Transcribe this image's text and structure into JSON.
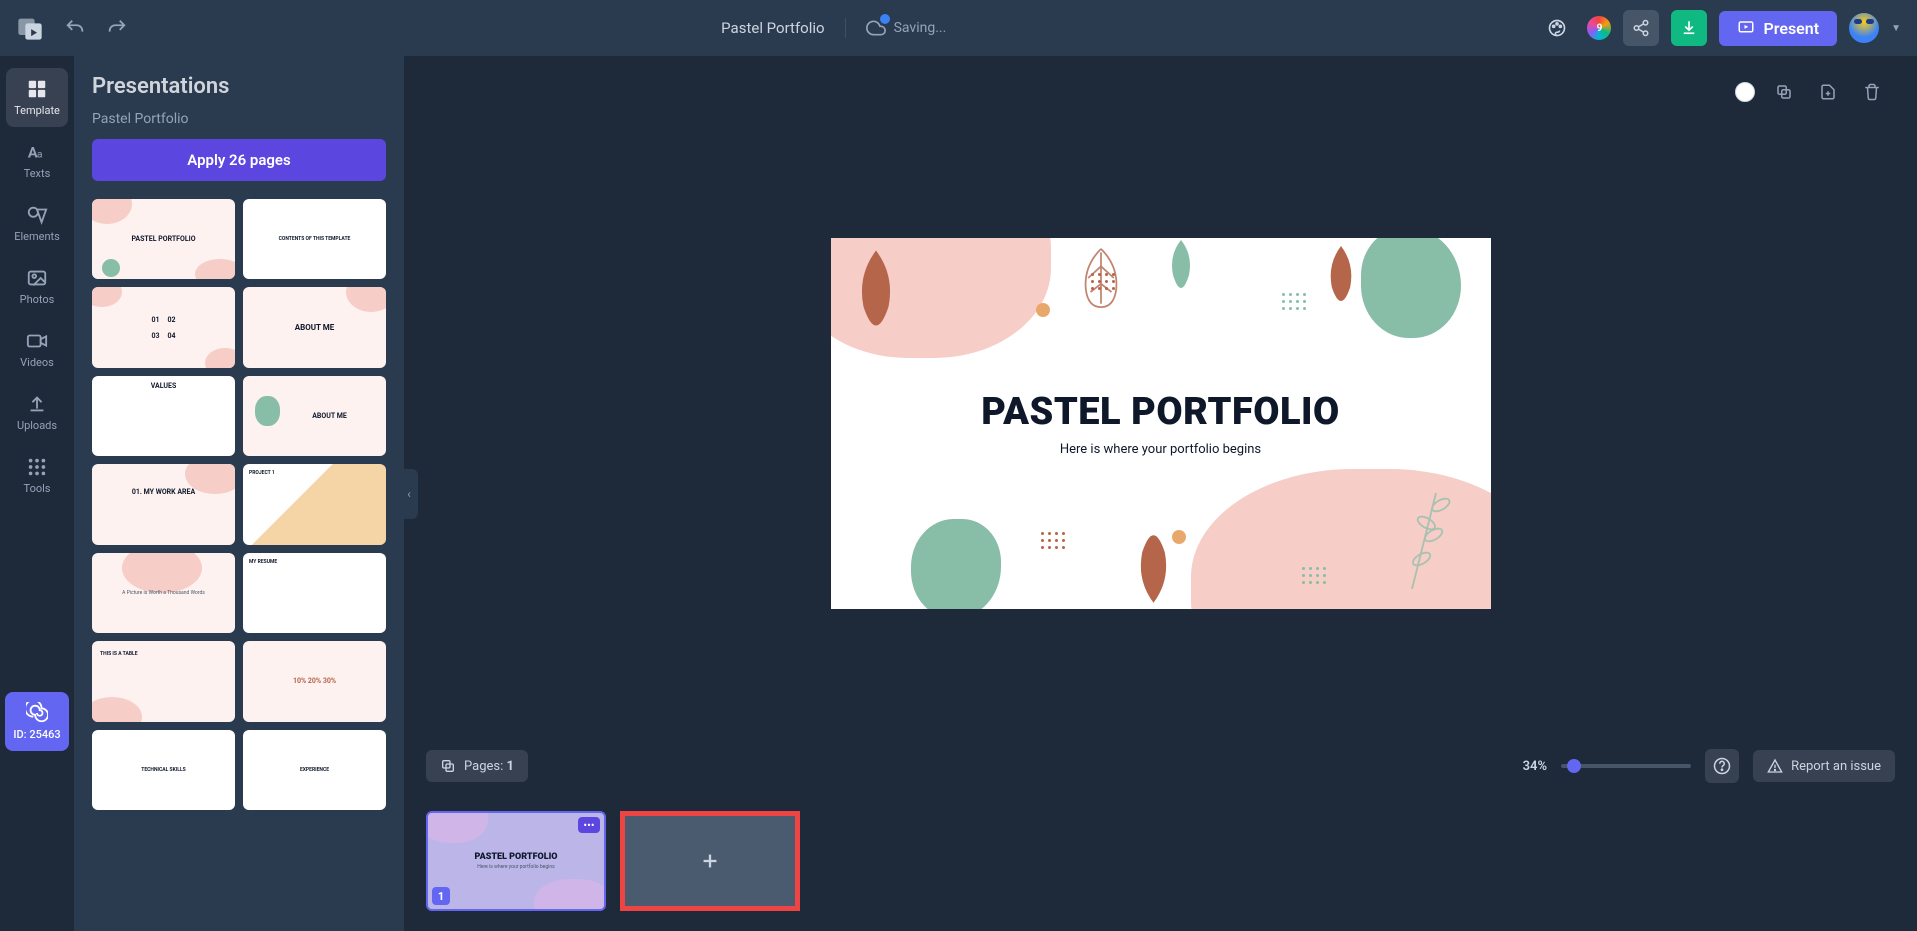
{
  "topbar": {
    "doc_title": "Pastel Portfolio",
    "saving_status": "Saving...",
    "present_label": "Present",
    "rainbow_count": "9"
  },
  "rail": {
    "items": [
      {
        "label": "Template"
      },
      {
        "label": "Texts"
      },
      {
        "label": "Elements"
      },
      {
        "label": "Photos"
      },
      {
        "label": "Videos"
      },
      {
        "label": "Uploads"
      },
      {
        "label": "Tools"
      }
    ],
    "id_badge": "ID: 25463"
  },
  "panel": {
    "title": "Presentations",
    "subtitle": "Pastel Portfolio",
    "apply_label": "Apply 26 pages",
    "thumbs": [
      {
        "text": "PASTEL PORTFOLIO"
      },
      {
        "text": "CONTENTS OF THIS TEMPLATE"
      },
      {
        "text": "01 02 03 04"
      },
      {
        "text": "ABOUT ME"
      },
      {
        "text": "VALUES"
      },
      {
        "text": "ABOUT ME"
      },
      {
        "text": "01. MY WORK AREA"
      },
      {
        "text": "PROJECT 1"
      },
      {
        "text": "A Picture is Worth a Thousand Words"
      },
      {
        "text": "MY RESUME"
      },
      {
        "text": "THIS IS A TABLE"
      },
      {
        "text": "10% 20% 30%"
      },
      {
        "text": "TECHNICAL SKILLS"
      },
      {
        "text": "EXPERIENCE"
      }
    ]
  },
  "slide": {
    "title": "PASTEL PORTFOLIO",
    "subtitle": "Here is where your portfolio begins"
  },
  "bottom": {
    "pages_label": "Pages: ",
    "pages_count": "1",
    "zoom": "34%",
    "report_label": "Report an issue"
  },
  "filmstrip": {
    "slide1_title": "PASTEL PORTFOLIO",
    "slide1_sub": "Here is where your portfolio begins",
    "slide1_num": "1",
    "slide1_menu": "•••"
  }
}
